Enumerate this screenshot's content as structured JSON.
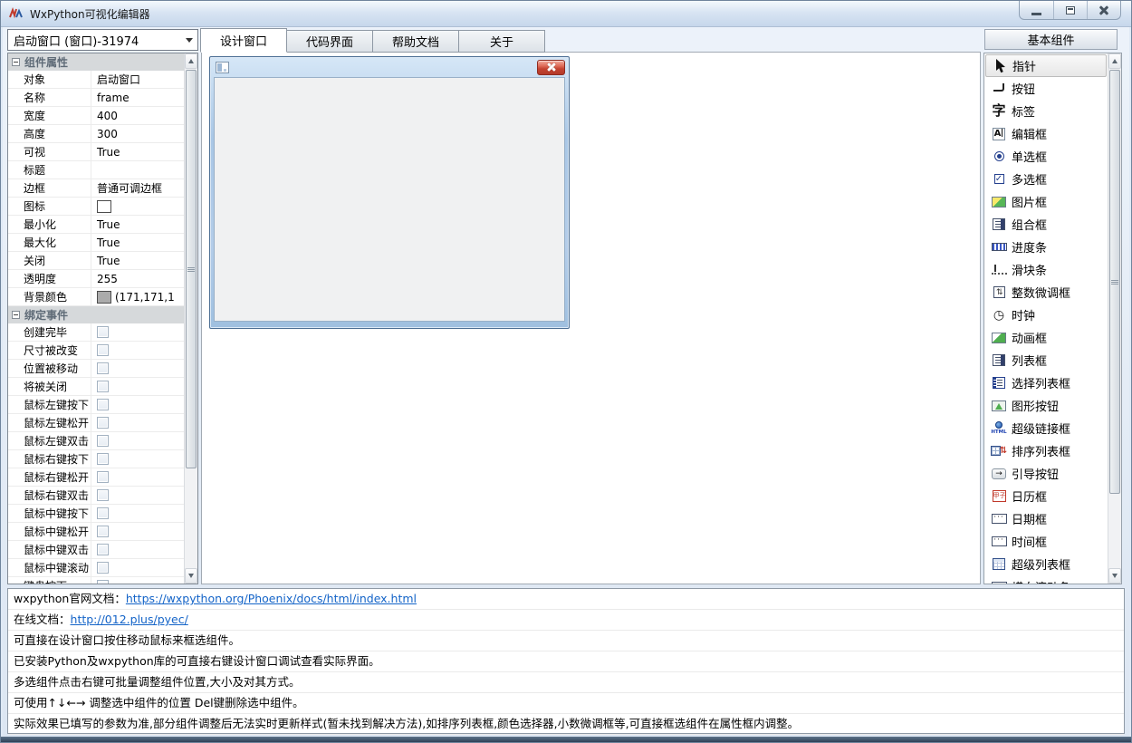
{
  "window": {
    "title": "WxPython可视化编辑器"
  },
  "titlebar_buttons": {
    "minimize": "minimize-button",
    "maximize": "maximize-button",
    "close": "close-button"
  },
  "selector": {
    "value": "启动窗口  (窗口)-31974"
  },
  "tabs": [
    {
      "label": "设计窗口",
      "active": true
    },
    {
      "label": "代码界面",
      "active": false
    },
    {
      "label": "帮助文档",
      "active": false
    },
    {
      "label": "关于",
      "active": false
    }
  ],
  "properties": {
    "header": "组件属性",
    "rows": [
      {
        "label": "对象",
        "value": "启动窗口"
      },
      {
        "label": "名称",
        "value": "frame"
      },
      {
        "label": "宽度",
        "value": "400"
      },
      {
        "label": "高度",
        "value": "300"
      },
      {
        "label": "可视",
        "value": "True"
      },
      {
        "label": "标题",
        "value": ""
      },
      {
        "label": "边框",
        "value": "普通可调边框"
      },
      {
        "label": "图标",
        "value": "",
        "swatch": "#ffffff"
      },
      {
        "label": "最小化",
        "value": "True"
      },
      {
        "label": "最大化",
        "value": "True"
      },
      {
        "label": "关闭",
        "value": "True"
      },
      {
        "label": "透明度",
        "value": "255"
      },
      {
        "label": "背景颜色",
        "value": "(171,171,1",
        "swatch": "#ababab"
      }
    ]
  },
  "events": {
    "header": "绑定事件",
    "rows": [
      "创建完毕",
      "尺寸被改变",
      "位置被移动",
      "将被关闭",
      "鼠标左键按下",
      "鼠标左键松开",
      "鼠标左键双击",
      "鼠标右键按下",
      "鼠标右键松开",
      "鼠标右键双击",
      "鼠标中键按下",
      "鼠标中键松开",
      "鼠标中键双击",
      "鼠标中键滚动",
      "键盘按下"
    ]
  },
  "palette": {
    "header": "基本组件",
    "items": [
      {
        "label": "指针",
        "icon": "pointer-icon",
        "selected": true
      },
      {
        "label": "按钮",
        "icon": "button-icon",
        "selected": false
      },
      {
        "label": "标签",
        "icon": "label-icon",
        "selected": false
      },
      {
        "label": "编辑框",
        "icon": "edit-icon",
        "selected": false
      },
      {
        "label": "单选框",
        "icon": "radio-icon",
        "selected": false
      },
      {
        "label": "多选框",
        "icon": "checkbox-icon",
        "selected": false
      },
      {
        "label": "图片框",
        "icon": "picture-icon",
        "selected": false
      },
      {
        "label": "组合框",
        "icon": "combobox-icon",
        "selected": false
      },
      {
        "label": "进度条",
        "icon": "progressbar-icon",
        "selected": false
      },
      {
        "label": "滑块条",
        "icon": "slider-icon",
        "selected": false
      },
      {
        "label": "整数微调框",
        "icon": "spinctrl-icon",
        "selected": false
      },
      {
        "label": "时钟",
        "icon": "clock-icon",
        "selected": false
      },
      {
        "label": "动画框",
        "icon": "animation-icon",
        "selected": false
      },
      {
        "label": "列表框",
        "icon": "listbox-icon",
        "selected": false
      },
      {
        "label": "选择列表框",
        "icon": "checklistbox-icon",
        "selected": false
      },
      {
        "label": "图形按钮",
        "icon": "graphic-button-icon",
        "selected": false
      },
      {
        "label": "超级链接框",
        "icon": "hyperlink-icon",
        "selected": false
      },
      {
        "label": "排序列表框",
        "icon": "sorted-list-icon",
        "selected": false
      },
      {
        "label": "引导按钮",
        "icon": "wizard-button-icon",
        "selected": false
      },
      {
        "label": "日历框",
        "icon": "calendar-icon",
        "selected": false
      },
      {
        "label": "日期框",
        "icon": "date-icon",
        "selected": false
      },
      {
        "label": "时间框",
        "icon": "time-icon",
        "selected": false
      },
      {
        "label": "超级列表框",
        "icon": "listctrl-icon",
        "selected": false
      },
      {
        "label": "横向滚动条",
        "icon": "scrollbar-icon",
        "selected": false
      }
    ]
  },
  "help": {
    "lines": [
      {
        "prefix": "wxpython官网文档：",
        "link": "https://wxpython.org/Phoenix/docs/html/index.html"
      },
      {
        "prefix": "在线文档：",
        "link": "http://012.plus/pyec/"
      },
      {
        "text": "可直接在设计窗口按住移动鼠标来框选组件。"
      },
      {
        "text": "已安装Python及wxpython库的可直接右键设计窗口调试查看实际界面。"
      },
      {
        "text": "多选组件点击右键可批量调整组件位置,大小及对其方式。"
      },
      {
        "text": "可使用↑↓←→ 调整选中组件的位置 Del键删除选中组件。"
      },
      {
        "text": "实际效果已填写的参数为准,部分组件调整后无法实时更新样式(暂未找到解决方法),如排序列表框,颜色选择器,小数微调框等,可直接框选组件在属性框内调整。"
      }
    ]
  },
  "colors": {
    "titlebar": "#d8e4f3",
    "preview_titlebar": "#a9c7e6",
    "close_button_red": "#c44331",
    "link_blue": "#1464c8",
    "background_swatch": "#ababab"
  }
}
